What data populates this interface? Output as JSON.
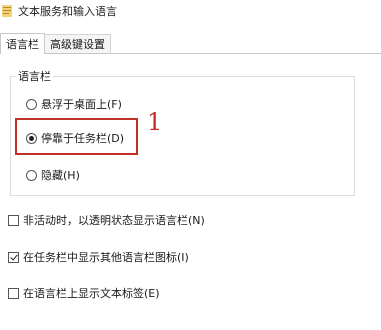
{
  "window": {
    "title": "文本服务和输入语言"
  },
  "tabs": [
    {
      "label": "语言栏",
      "active": true
    },
    {
      "label": "高级键设置",
      "active": false
    }
  ],
  "language_bar_group": {
    "label": "语言栏",
    "options": [
      {
        "label": "悬浮于桌面上(F)",
        "checked": false
      },
      {
        "label": "停靠于任务栏(D)",
        "checked": true
      },
      {
        "label": "隐藏(H)",
        "checked": false
      }
    ]
  },
  "annotation": {
    "number": "1",
    "color": "#c2302a"
  },
  "checkboxes": [
    {
      "label": "非活动时，以透明状态显示语言栏(N)",
      "checked": false
    },
    {
      "label": "在任务栏中显示其他语言栏图标(I)",
      "checked": true
    },
    {
      "label": "在语言栏上显示文本标签(E)",
      "checked": false
    }
  ]
}
